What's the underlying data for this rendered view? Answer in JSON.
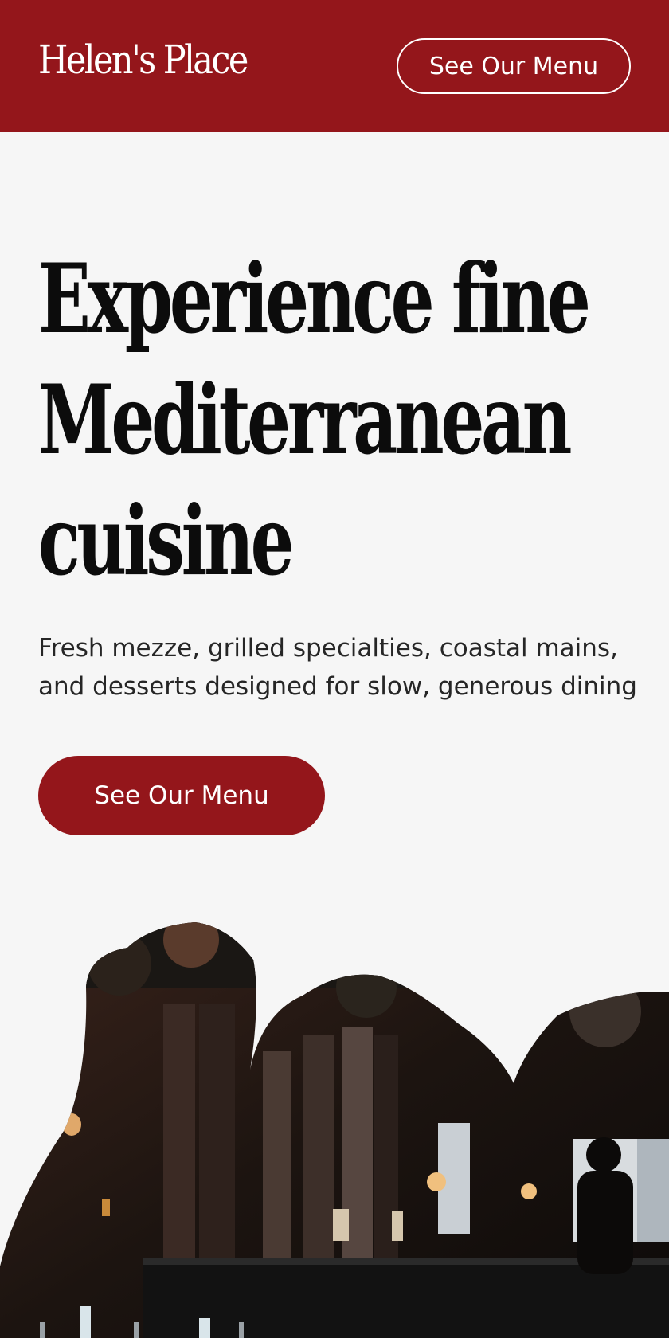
{
  "header": {
    "logo": "Helen's Place",
    "menu_button_label": "See Our Menu"
  },
  "hero": {
    "title_lines": [
      "Experience fine",
      "Mediterranean",
      "cuisine"
    ],
    "subtitle": "Fresh mezze, grilled specialties, coastal mains, and desserts designed for slow, generous dining",
    "cta_label": "See Our Menu"
  },
  "colors": {
    "brand": "#94161b",
    "background": "#f6f6f6",
    "text": "#0c0c0c"
  }
}
